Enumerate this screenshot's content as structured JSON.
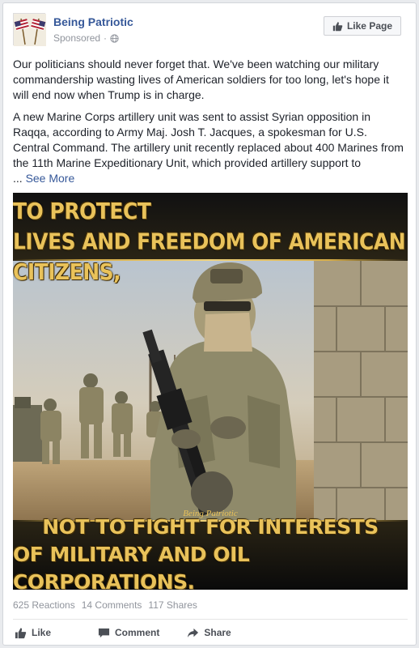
{
  "post": {
    "page_name": "Being Patriotic",
    "sponsored_label": "Sponsored",
    "separator": "·",
    "like_page_label": "Like Page",
    "paragraph_1": "Our politicians should never forget that. We've been watching our military commandership wasting lives of American soldiers for too long, let's hope it will end now when Trump is in charge.",
    "paragraph_2": "A new Marine Corps artillery unit was sent to assist Syrian opposition in Raqqa, according to Army Maj. Josh T. Jacques, a spokesman for U.S. Central Command. The artillery unit recently replaced about 400 Marines from the 11th Marine Expeditionary Unit, which provided artillery support to",
    "ellipsis": "...",
    "see_more_label": "See More"
  },
  "image": {
    "top_line_1": "THE AMERICAN SOLDIER SERVES TO PROTECT",
    "top_line_2": "LIVES AND FREEDOM OF AMERICAN CITIZENS,",
    "watermark": "Being Patriotic",
    "bottom_line_1": "NOT TO FIGHT FOR INTERESTS",
    "bottom_line_2": "OF MILITARY AND OIL CORPORATIONS."
  },
  "engagement": {
    "reactions": "625 Reactions",
    "comments": "14 Comments",
    "shares": "117 Shares"
  },
  "actions": {
    "like_label": "Like",
    "comment_label": "Comment",
    "share_label": "Share"
  },
  "colors": {
    "link_blue": "#365899",
    "meme_gold": "#e9c25a",
    "muted_gray": "#90949c"
  },
  "icons": {
    "avatar": "flags-avatar-icon",
    "globe": "globe-icon",
    "thumbs_up": "thumbs-up-icon",
    "comment": "comment-icon",
    "share": "share-arrow-icon"
  }
}
